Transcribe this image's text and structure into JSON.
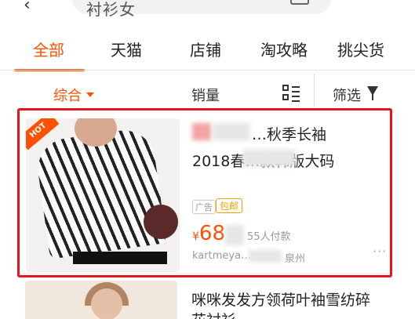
{
  "search": {
    "query": "衬衫女"
  },
  "tabs": [
    "全部",
    "天猫",
    "店铺",
    "淘攻略",
    "挑尖货"
  ],
  "sort": {
    "comprehensive": "综合",
    "sales": "销量",
    "filter": "筛选"
  },
  "product1": {
    "hot_badge": "HOT",
    "title_line1": "…秋季长袖",
    "title_line2": "2018春…款韩版大码",
    "ad": "广告",
    "free_shipping": "包邮",
    "price_currency": "¥",
    "price": "68",
    "sales": "55人付款",
    "shop": "kartmeya…",
    "location": "泉州"
  },
  "product2": {
    "title_line1": "咪咪发发方领荷叶袖雪纺碎",
    "title_line2": "花衬衫"
  },
  "colors": {
    "accent": "#ff5000",
    "highlight_border": "#e8141c"
  }
}
